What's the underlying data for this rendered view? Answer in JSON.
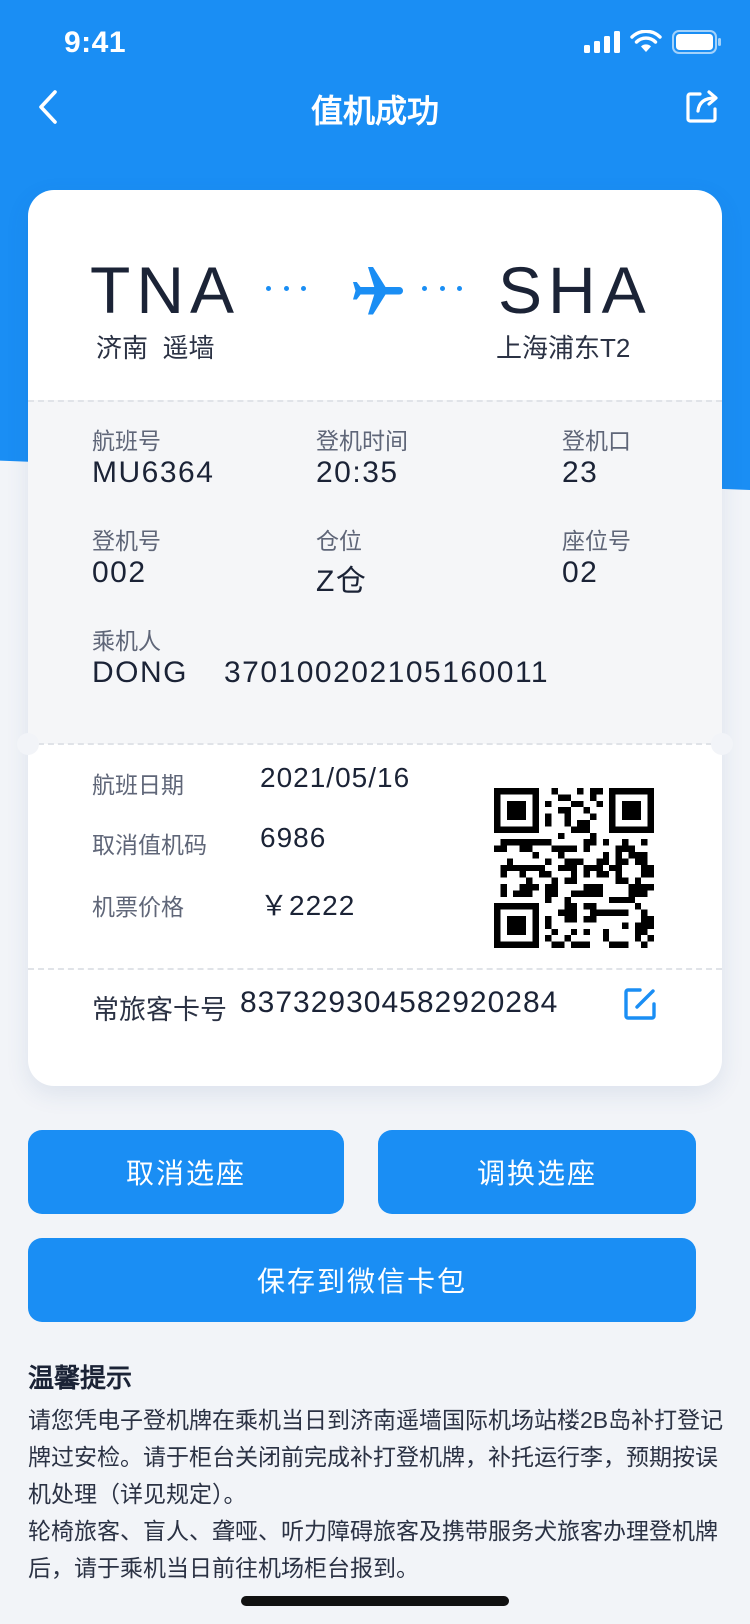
{
  "status_bar": {
    "time": "9:41"
  },
  "nav": {
    "title": "值机成功"
  },
  "route": {
    "origin_code": "TNA",
    "origin_name": "济南  遥墙",
    "dest_code": "SHA",
    "dest_name": "上海浦东T2"
  },
  "flight_info": {
    "flight_no_label": "航班号",
    "flight_no": "MU6364",
    "boarding_time_label": "登机时间",
    "boarding_time": "20:35",
    "gate_label": "登机口",
    "gate": "23",
    "boarding_no_label": "登机号",
    "boarding_no": "002",
    "cabin_label": "仓位",
    "cabin": "Z仓",
    "seat_label": "座位号",
    "seat": "02",
    "passenger_label": "乘机人",
    "passenger_name": "DONG",
    "passenger_id": "370100202105160011"
  },
  "ticket": {
    "date_label": "航班日期",
    "date": "2021/05/16",
    "cancel_code_label": "取消值机码",
    "cancel_code": "6986",
    "price_label": "机票价格",
    "price": "￥2222"
  },
  "frequent_flyer": {
    "label": "常旅客卡号",
    "number": "837329304582920284"
  },
  "buttons": {
    "cancel_seat": "取消选座",
    "change_seat": "调换选座",
    "save_wechat": "保存到微信卡包"
  },
  "tips": {
    "title": "温馨提示",
    "paragraph1": "请您凭电子登机牌在乘机当日到济南遥墙国际机场站楼2B岛补打登记牌过安检。请于柜台关闭前完成补打登机牌，补托运行李，预期按误机处理（详见规定）。",
    "paragraph2": "轮椅旅客、盲人、聋哑、听力障碍旅客及携带服务犬旅客办理登机牌后，请于乘机当日前往机场柜台报到。"
  },
  "colors": {
    "primary": "#1a8ef4",
    "text": "#1b2336",
    "muted": "#5f6678",
    "background": "#f2f4f8"
  },
  "icons": [
    "back-icon",
    "share-icon",
    "plane-icon",
    "qr-code",
    "edit-icon",
    "signal-icon",
    "wifi-icon",
    "battery-icon"
  ]
}
